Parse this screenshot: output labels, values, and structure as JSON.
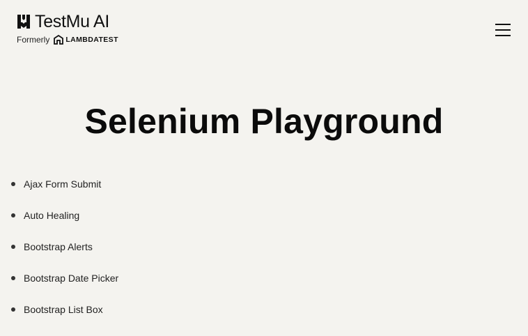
{
  "header": {
    "brand_name": "TestMu AI",
    "formerly_label": "Formerly",
    "former_brand": "LAMBDATEST",
    "menu_icon": "hamburger-menu-icon"
  },
  "main": {
    "title": "Selenium Playground",
    "demos": [
      {
        "label": "Ajax Form Submit"
      },
      {
        "label": "Auto Healing"
      },
      {
        "label": "Bootstrap Alerts"
      },
      {
        "label": "Bootstrap Date Picker"
      },
      {
        "label": "Bootstrap List Box"
      }
    ]
  },
  "colors": {
    "background": "#f4f3ef",
    "text": "#111111"
  }
}
